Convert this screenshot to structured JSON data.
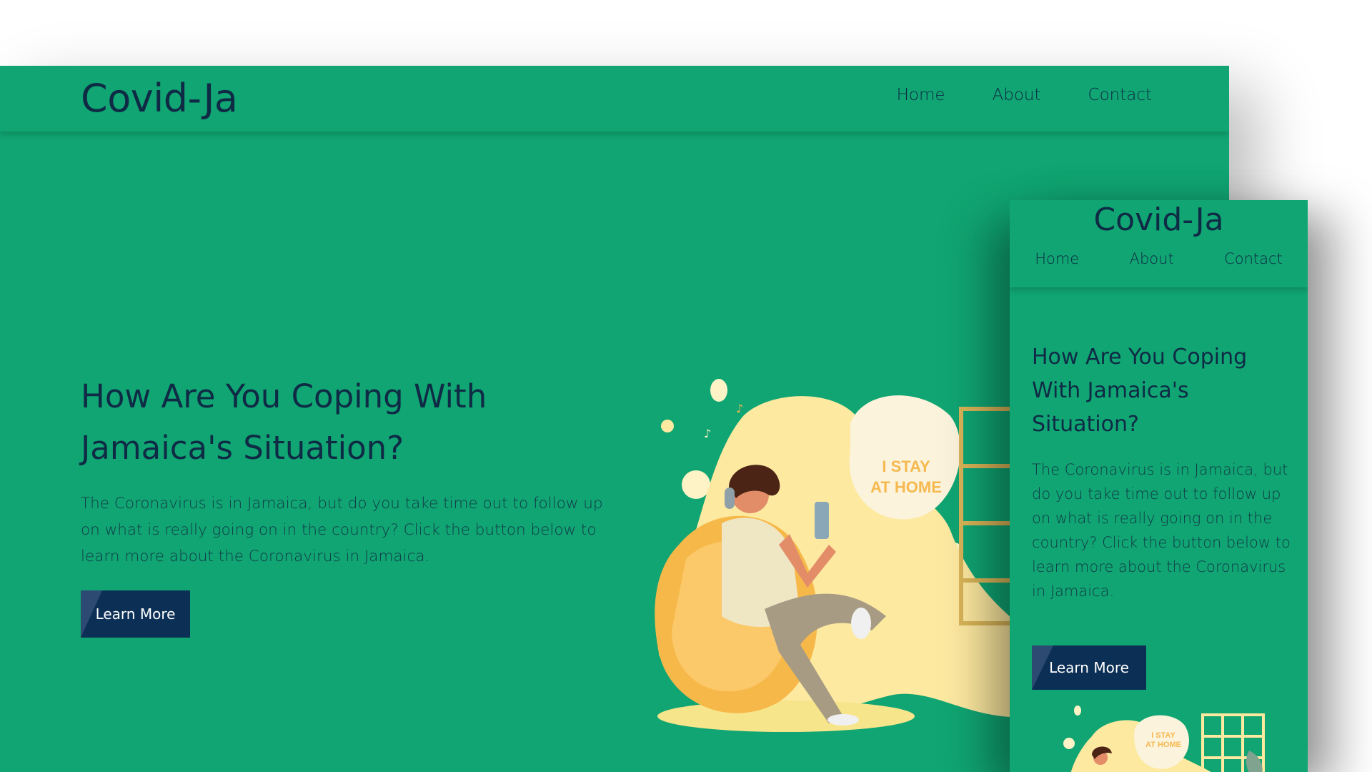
{
  "desktop": {
    "logo": "Covid-Ja",
    "nav": [
      "Home",
      "About",
      "Contact"
    ],
    "heading": "How Are You Coping With Jamaica's Situation?",
    "paragraph": "The Coronavirus is in Jamaica, but do you take time out to follow up on what is really going on in the country? Click the button below to learn more about the Coronavirus in Jamaica.",
    "button_label": "Learn More",
    "illustration_text": [
      "I STAY",
      "AT HOME"
    ]
  },
  "mobile": {
    "logo": "Covid-Ja",
    "nav": [
      "Home",
      "About",
      "Contact"
    ],
    "heading": "How Are You Coping With Jamaica's Situation?",
    "paragraph": "The Coronavirus is in Jamaica, but do you take time out to follow up on what is really going on in the country? Click the button below to learn more about the Coronavirus in Jamaica.",
    "button_label": "Learn More",
    "illustration_text": [
      "I STAY",
      "AT HOME"
    ]
  },
  "colors": {
    "brand_green": "#10a572",
    "navy": "#0f2a45",
    "button_navy": "#0c2f55",
    "yellow": "#fde9a0",
    "orange": "#f6b94f"
  }
}
